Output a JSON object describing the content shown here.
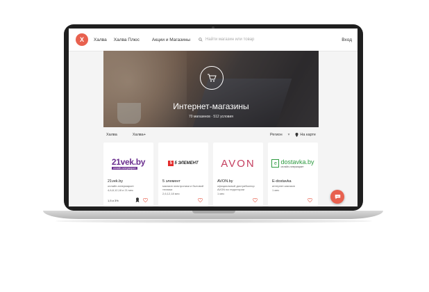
{
  "header": {
    "logo_letter": "Х",
    "nav": [
      "Халва",
      "Халва Плюс",
      "Акции и Магазины"
    ],
    "search_placeholder": "Найти магазин или товар",
    "login": "Вход"
  },
  "hero": {
    "title": "Интернет-магазины",
    "subtitle": "70 магазинов · 512 условия"
  },
  "filters": {
    "left": [
      "Халва",
      "Халва+"
    ],
    "region": "Регион",
    "map": "На карте"
  },
  "cards": [
    {
      "logo": "21vek.by",
      "logo_sub": "онлайн-гипермаркет",
      "name": "21vek.by",
      "desc": "онлайн-гипермаркет",
      "term": "4,6,8,12,18 и 21 мес",
      "limit": "1,5 и 3%"
    },
    {
      "logo": "5 ЭЛЕМЕНТ",
      "name": "5 элемент",
      "desc": "магазин электроники и бытовой техники",
      "term": "2,6,12,18 мес"
    },
    {
      "logo": "AVON",
      "name": "AVON.by",
      "desc": "официальный дистрибьютор AVON на территории",
      "term": "1 мес"
    },
    {
      "logo": "dostavka.by",
      "logo_sub": "онлайн-гипермаркет",
      "name": "E-dostavka",
      "desc": "интернет-магазин",
      "term": "1 мес"
    }
  ],
  "colors": {
    "accent": "#e8614f",
    "avon": "#c43d5e",
    "vek": "#6b2f8f",
    "dostavka": "#2d9a3f"
  }
}
